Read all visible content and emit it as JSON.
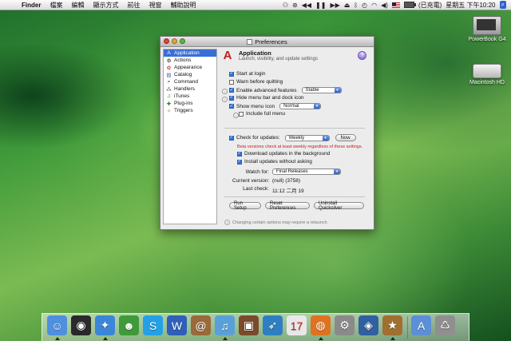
{
  "menubar": {
    "app": "Finder",
    "items": [
      "檔案",
      "編輯",
      "顯示方式",
      "前往",
      "視窗",
      "輔助說明"
    ],
    "input_label": "(已充電)",
    "clock": "星期五 下午10:20",
    "battery_level": 1.0
  },
  "desktop": [
    {
      "label": "PowerBook G4",
      "icon": "laptop-icon"
    },
    {
      "label": "Macintosh HD",
      "icon": "hard-disk-icon"
    }
  ],
  "window": {
    "title": "Preferences",
    "sidebar": [
      {
        "label": "Application",
        "icon": "application-icon",
        "selected": true
      },
      {
        "label": "Actions",
        "icon": "gear-icon"
      },
      {
        "label": "Appearance",
        "icon": "appearance-icon"
      },
      {
        "label": "Catalog",
        "icon": "catalog-icon"
      },
      {
        "label": "Command",
        "icon": "command-icon"
      },
      {
        "label": "Handlers",
        "icon": "handlers-icon"
      },
      {
        "label": "iTunes",
        "icon": "music-note-icon"
      },
      {
        "label": "Plug-ins",
        "icon": "plugin-icon"
      },
      {
        "label": "Triggers",
        "icon": "trigger-icon"
      }
    ],
    "header": {
      "title": "Application",
      "subtitle": "Launch, visibility, and update settings"
    },
    "options": {
      "start_at_login": {
        "label": "Start at login",
        "checked": true
      },
      "warn_before_quitting": {
        "label": "Warn before quitting",
        "checked": false
      },
      "enable_advanced": {
        "label": "Enable advanced features",
        "checked": true,
        "select": "Stable"
      },
      "hide_menubar_dock": {
        "label": "Hide menu bar and dock icon",
        "checked": true
      },
      "show_menu_icon": {
        "label": "Show menu icon",
        "checked": true,
        "select": "Normal"
      },
      "include_full_menu": {
        "label": "Include full menu",
        "checked": false
      }
    },
    "updates": {
      "check_label": "Check for updates:",
      "check_checked": true,
      "frequency": "Weekly",
      "now_button": "Now",
      "warning": "Beta versions check at least weekly regardless of these settings.",
      "download_bg": {
        "label": "Download updates in the background",
        "checked": true
      },
      "install_without_asking": {
        "label": "Install updates without asking",
        "checked": true
      },
      "watch_for_label": "Watch for:",
      "watch_for": "Final Releases",
      "current_version_label": "Current version:",
      "current_version": "(null) (3758)",
      "last_check_label": "Last check:",
      "last_check": "11:12 二月 19"
    },
    "buttons": {
      "run_setup": "Run Setup",
      "reset_preferences": "Reset Preferences",
      "uninstall": "Uninstall Quicksilver"
    },
    "footer": "Changing certain options may require a relaunch"
  },
  "dock": [
    {
      "name": "finder",
      "icon": "finder-icon",
      "glyph": "☺",
      "color": "#4f8fe0",
      "running": true
    },
    {
      "name": "dashboard",
      "icon": "dashboard-icon",
      "glyph": "◉",
      "color": "#2a2a2a",
      "running": false
    },
    {
      "name": "safari",
      "icon": "safari-icon",
      "glyph": "✦",
      "color": "#3b86d8",
      "running": true
    },
    {
      "name": "adium",
      "icon": "adium-icon",
      "glyph": "☻",
      "color": "#3f9a3a",
      "running": false
    },
    {
      "name": "skype",
      "icon": "skype-icon",
      "glyph": "S",
      "color": "#24a0e6",
      "running": false
    },
    {
      "name": "word",
      "icon": "word-icon",
      "glyph": "W",
      "color": "#2f5fb8",
      "running": false
    },
    {
      "name": "address-book",
      "icon": "address-book-icon",
      "glyph": "@",
      "color": "#9a6a3a",
      "running": false
    },
    {
      "name": "itunes",
      "icon": "itunes-icon",
      "glyph": "♫",
      "color": "#5aa0d8",
      "running": true
    },
    {
      "name": "photo-booth",
      "icon": "photo-icon",
      "glyph": "▣",
      "color": "#7a4a2a",
      "running": false
    },
    {
      "name": "feather",
      "icon": "feather-icon",
      "glyph": "➶",
      "color": "#2f7fc0",
      "running": false
    },
    {
      "name": "ical",
      "icon": "calendar-icon",
      "glyph": "17",
      "color": "#e8e8e8",
      "running": false
    },
    {
      "name": "firefox",
      "icon": "firefox-icon",
      "glyph": "◍",
      "color": "#e0721f",
      "running": true
    },
    {
      "name": "system-preferences",
      "icon": "system-preferences-icon",
      "glyph": "⚙",
      "color": "#8a8a8a",
      "running": false
    },
    {
      "name": "preview",
      "icon": "preview-icon",
      "glyph": "◈",
      "color": "#3060a0",
      "running": false
    },
    {
      "name": "quicksilver",
      "icon": "quicksilver-icon",
      "glyph": "★",
      "color": "#a07030",
      "running": true
    },
    {
      "name": "applications",
      "icon": "folder-icon",
      "glyph": "A",
      "color": "#5b8fd6",
      "running": false
    },
    {
      "name": "trash",
      "icon": "trash-icon",
      "glyph": "♺",
      "color": "#8f8f8f",
      "running": false
    }
  ]
}
